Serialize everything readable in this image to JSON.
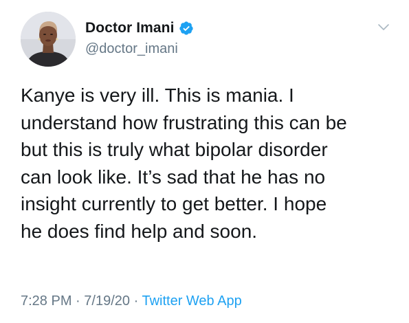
{
  "author": {
    "display_name": "Doctor Imani",
    "handle": "@doctor_imani",
    "verified": true
  },
  "tweet": {
    "lines": [
      "Kanye is very ill. This is mania. I",
      "understand how frustrating this can be",
      "but this is truly what bipolar disorder",
      "can look like. It’s sad that he has no",
      "insight currently to get better. I hope",
      "he does find help and soon."
    ]
  },
  "meta": {
    "time": "7:28 PM",
    "separator": "·",
    "date": "7/19/20",
    "source": "Twitter Web App"
  },
  "icons": {
    "verified": "verified-badge-icon",
    "menu": "chevron-down-icon"
  },
  "colors": {
    "text": "#14171a",
    "secondary": "#657786",
    "accent": "#1da1f2",
    "chevron": "#aab8c2"
  }
}
